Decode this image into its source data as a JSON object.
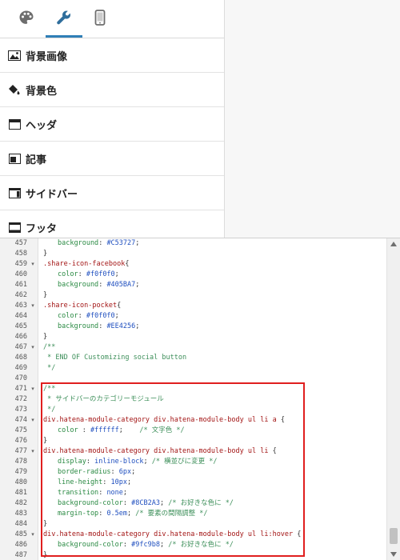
{
  "tabs": [
    {
      "name": "palette",
      "icon": "palette-icon",
      "active": false
    },
    {
      "name": "wrench",
      "icon": "wrench-icon",
      "active": true
    },
    {
      "name": "mobile",
      "icon": "mobile-icon",
      "active": false
    }
  ],
  "menu": [
    {
      "label": "背景画像",
      "icon": "image-icon"
    },
    {
      "label": "背景色",
      "icon": "paint-bucket-icon"
    },
    {
      "label": "ヘッダ",
      "icon": "layout-header-icon"
    },
    {
      "label": "記事",
      "icon": "layout-article-icon"
    },
    {
      "label": "サイドバー",
      "icon": "layout-sidebar-icon"
    },
    {
      "label": "フッタ",
      "icon": "layout-footer-icon"
    }
  ],
  "editor": {
    "lines": [
      {
        "n": "457",
        "fold": false,
        "indent": 1,
        "tokens": [
          [
            "prop",
            "background"
          ],
          [
            "punc",
            ": "
          ],
          [
            "val",
            "#C53727"
          ],
          [
            "punc",
            ";"
          ]
        ]
      },
      {
        "n": "458",
        "fold": false,
        "indent": 0,
        "tokens": [
          [
            "punc",
            "}"
          ]
        ]
      },
      {
        "n": "459",
        "fold": true,
        "indent": 0,
        "tokens": [
          [
            "sel",
            ".share-icon-facebook"
          ],
          [
            "punc",
            "{"
          ]
        ]
      },
      {
        "n": "460",
        "fold": false,
        "indent": 1,
        "tokens": [
          [
            "prop",
            "color"
          ],
          [
            "punc",
            ": "
          ],
          [
            "val",
            "#f0f0f0"
          ],
          [
            "punc",
            ";"
          ]
        ]
      },
      {
        "n": "461",
        "fold": false,
        "indent": 1,
        "tokens": [
          [
            "prop",
            "background"
          ],
          [
            "punc",
            ": "
          ],
          [
            "val",
            "#405BA7"
          ],
          [
            "punc",
            ";"
          ]
        ]
      },
      {
        "n": "462",
        "fold": false,
        "indent": 0,
        "tokens": [
          [
            "punc",
            "}"
          ]
        ]
      },
      {
        "n": "463",
        "fold": true,
        "indent": 0,
        "tokens": [
          [
            "sel",
            ".share-icon-pocket"
          ],
          [
            "punc",
            "{"
          ]
        ]
      },
      {
        "n": "464",
        "fold": false,
        "indent": 1,
        "tokens": [
          [
            "prop",
            "color"
          ],
          [
            "punc",
            ": "
          ],
          [
            "val",
            "#f0f0f0"
          ],
          [
            "punc",
            ";"
          ]
        ]
      },
      {
        "n": "465",
        "fold": false,
        "indent": 1,
        "tokens": [
          [
            "prop",
            "background"
          ],
          [
            "punc",
            ": "
          ],
          [
            "val",
            "#EE4256"
          ],
          [
            "punc",
            ";"
          ]
        ]
      },
      {
        "n": "466",
        "fold": false,
        "indent": 0,
        "tokens": [
          [
            "punc",
            "}"
          ]
        ]
      },
      {
        "n": "467",
        "fold": true,
        "indent": 0,
        "tokens": [
          [
            "cmt",
            "/**"
          ]
        ]
      },
      {
        "n": "468",
        "fold": false,
        "indent": 0,
        "tokens": [
          [
            "cmt",
            " * END OF Customizing social button"
          ]
        ]
      },
      {
        "n": "469",
        "fold": false,
        "indent": 0,
        "tokens": [
          [
            "cmt",
            " */"
          ]
        ]
      },
      {
        "n": "470",
        "fold": false,
        "indent": 0,
        "tokens": []
      },
      {
        "n": "471",
        "fold": true,
        "indent": 0,
        "tokens": [
          [
            "cmt",
            "/**"
          ]
        ]
      },
      {
        "n": "472",
        "fold": false,
        "indent": 0,
        "tokens": [
          [
            "cmt",
            " * サイドバーのカテゴリーモジュール"
          ]
        ]
      },
      {
        "n": "473",
        "fold": false,
        "indent": 0,
        "tokens": [
          [
            "cmt",
            " */"
          ]
        ]
      },
      {
        "n": "474",
        "fold": true,
        "indent": 0,
        "tokens": [
          [
            "sel",
            "div.hatena-module-category div.hatena-module-body ul li a"
          ],
          [
            "punc",
            " {"
          ]
        ]
      },
      {
        "n": "475",
        "fold": false,
        "indent": 1,
        "tokens": [
          [
            "prop",
            "color"
          ],
          [
            "punc",
            " : "
          ],
          [
            "val",
            "#ffffff"
          ],
          [
            "punc",
            ";    "
          ],
          [
            "cmt",
            "/* 文字色 */"
          ]
        ]
      },
      {
        "n": "476",
        "fold": false,
        "indent": 0,
        "tokens": [
          [
            "punc",
            "}"
          ]
        ]
      },
      {
        "n": "477",
        "fold": true,
        "indent": 0,
        "tokens": [
          [
            "sel",
            "div.hatena-module-category div.hatena-module-body ul li"
          ],
          [
            "punc",
            " {"
          ]
        ]
      },
      {
        "n": "478",
        "fold": false,
        "indent": 1,
        "tokens": [
          [
            "prop",
            "display"
          ],
          [
            "punc",
            ": "
          ],
          [
            "val",
            "inline-block"
          ],
          [
            "punc",
            "; "
          ],
          [
            "cmt",
            "/* 横並びに変更 */"
          ]
        ]
      },
      {
        "n": "479",
        "fold": false,
        "indent": 1,
        "tokens": [
          [
            "prop",
            "border-radius"
          ],
          [
            "punc",
            ": "
          ],
          [
            "val",
            "6px"
          ],
          [
            "punc",
            ";"
          ]
        ]
      },
      {
        "n": "480",
        "fold": false,
        "indent": 1,
        "tokens": [
          [
            "prop",
            "line-height"
          ],
          [
            "punc",
            ": "
          ],
          [
            "val",
            "10px"
          ],
          [
            "punc",
            ";"
          ]
        ]
      },
      {
        "n": "481",
        "fold": false,
        "indent": 1,
        "tokens": [
          [
            "prop",
            "transition"
          ],
          [
            "punc",
            ": "
          ],
          [
            "val",
            "none"
          ],
          [
            "punc",
            ";"
          ]
        ]
      },
      {
        "n": "482",
        "fold": false,
        "indent": 1,
        "tokens": [
          [
            "prop",
            "background-color"
          ],
          [
            "punc",
            ": "
          ],
          [
            "val",
            "#8CB2A3"
          ],
          [
            "punc",
            "; "
          ],
          [
            "cmt",
            "/* お好きな色に */"
          ]
        ]
      },
      {
        "n": "483",
        "fold": false,
        "indent": 1,
        "tokens": [
          [
            "prop",
            "margin-top"
          ],
          [
            "punc",
            ": "
          ],
          [
            "val",
            "0.5em"
          ],
          [
            "punc",
            "; "
          ],
          [
            "cmt",
            "/* 要素の間隔調整 */"
          ]
        ]
      },
      {
        "n": "484",
        "fold": false,
        "indent": 0,
        "tokens": [
          [
            "punc",
            "}"
          ]
        ]
      },
      {
        "n": "485",
        "fold": true,
        "indent": 0,
        "tokens": [
          [
            "sel",
            "div.hatena-module-category div.hatena-module-body ul li:hover"
          ],
          [
            "punc",
            " {"
          ]
        ]
      },
      {
        "n": "486",
        "fold": false,
        "indent": 1,
        "tokens": [
          [
            "prop",
            "background-color"
          ],
          [
            "punc",
            ": "
          ],
          [
            "val",
            "#9fc9b8"
          ],
          [
            "punc",
            "; "
          ],
          [
            "cmt",
            "/* お好きな色に */"
          ]
        ]
      },
      {
        "n": "487",
        "fold": false,
        "indent": 0,
        "tokens": [
          [
            "punc",
            "}"
          ]
        ]
      }
    ]
  },
  "colors": {
    "accent": "#2f7fb7",
    "highlight": "#e01f1f",
    "selector": "#a31515",
    "property": "#2a8a43",
    "value": "#1f4fbf",
    "comment": "#3d8f5a"
  }
}
